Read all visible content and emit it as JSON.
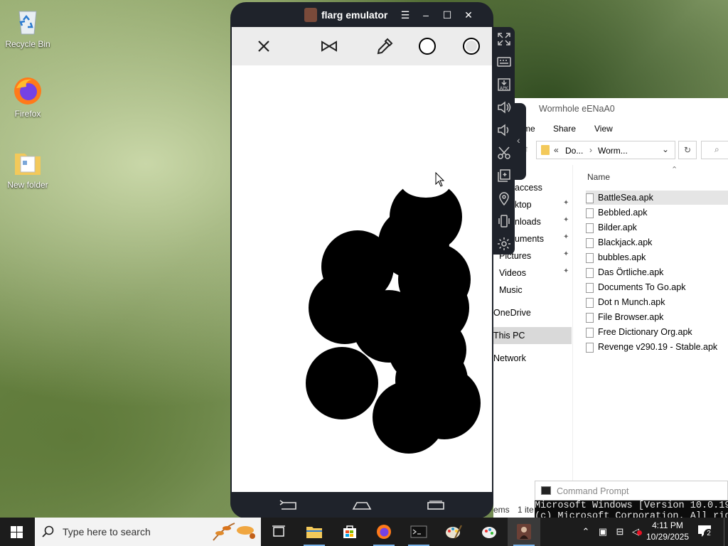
{
  "desktop": {
    "icons": [
      {
        "label": "Recycle Bin"
      },
      {
        "label": "Firefox"
      },
      {
        "label": "New folder"
      }
    ]
  },
  "emulator": {
    "title": "flarg emulator",
    "toolbar_icons": [
      "close-icon",
      "bowtie-icon",
      "eyedropper-icon",
      "circle-outline-icon",
      "circle-filled-icon"
    ],
    "side_icons": [
      "fullscreen-icon",
      "keyboard-icon",
      "apk-install-icon",
      "volume-up-icon",
      "volume-down-icon",
      "scissors-icon",
      "multi-window-icon",
      "location-icon",
      "shake-icon",
      "settings-icon"
    ]
  },
  "explorer": {
    "title": "Wormhole eENaA0",
    "ribbon": {
      "home": "me",
      "share": "Share",
      "view": "View"
    },
    "address": {
      "part1": "Do...",
      "part2": "Worm..."
    },
    "column_name": "Name",
    "nav": [
      {
        "label": "access"
      },
      {
        "label": "ktop"
      },
      {
        "label": "nloads"
      },
      {
        "label": "uments"
      },
      {
        "label": "Pictures"
      },
      {
        "label": "Videos"
      },
      {
        "label": "Music"
      },
      {
        "label": "OneDrive"
      },
      {
        "label": "This PC"
      },
      {
        "label": "Network"
      }
    ],
    "files": [
      {
        "name": "BattleSea.apk"
      },
      {
        "name": "Bebbled.apk"
      },
      {
        "name": "Bilder.apk"
      },
      {
        "name": "Blackjack.apk"
      },
      {
        "name": "bubbles.apk"
      },
      {
        "name": "Das Örtliche.apk"
      },
      {
        "name": "Documents To Go.apk"
      },
      {
        "name": "Dot n Munch.apk"
      },
      {
        "name": "File Browser.apk"
      },
      {
        "name": "Free Dictionary Org.apk"
      },
      {
        "name": "Revenge v290.19 - Stable.apk"
      }
    ],
    "status": {
      "items": "ems",
      "selected": "1 ite"
    }
  },
  "cmd": {
    "title": "Command Prompt",
    "line1": "Microsoft Windows [Version 10.0.19",
    "line2": "(c) Microsoft Corporation. All rig"
  },
  "taskbar": {
    "search_placeholder": "Type here to search",
    "time": "4:11 PM",
    "date": "10/29/2025",
    "notification_count": "2"
  }
}
